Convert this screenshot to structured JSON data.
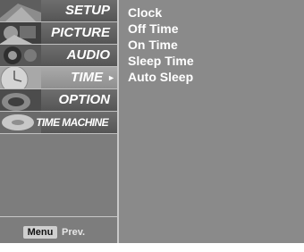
{
  "sidebar": {
    "items": [
      {
        "label": "SETUP",
        "icon": "setup-thumbnail-icon"
      },
      {
        "label": "PICTURE",
        "icon": "picture-thumbnail-icon"
      },
      {
        "label": "AUDIO",
        "icon": "audio-thumbnail-icon"
      },
      {
        "label": "TIME",
        "icon": "time-thumbnail-icon",
        "active": true,
        "arrow": "►"
      },
      {
        "label": "OPTION",
        "icon": "option-thumbnail-icon"
      },
      {
        "label": "TIME MACHINE",
        "icon": "time-machine-thumbnail-icon"
      }
    ]
  },
  "footer": {
    "menu_key": "Menu",
    "prev_label": "Prev."
  },
  "submenu": {
    "items": [
      "Clock",
      "Off Time",
      "On Time",
      "Sleep Time",
      "Auto Sleep"
    ]
  },
  "colors": {
    "panel": "#8a8a8a",
    "sidebar": "#7d7d7d",
    "active_item": "#9c9c9c",
    "text": "#ffffff"
  }
}
